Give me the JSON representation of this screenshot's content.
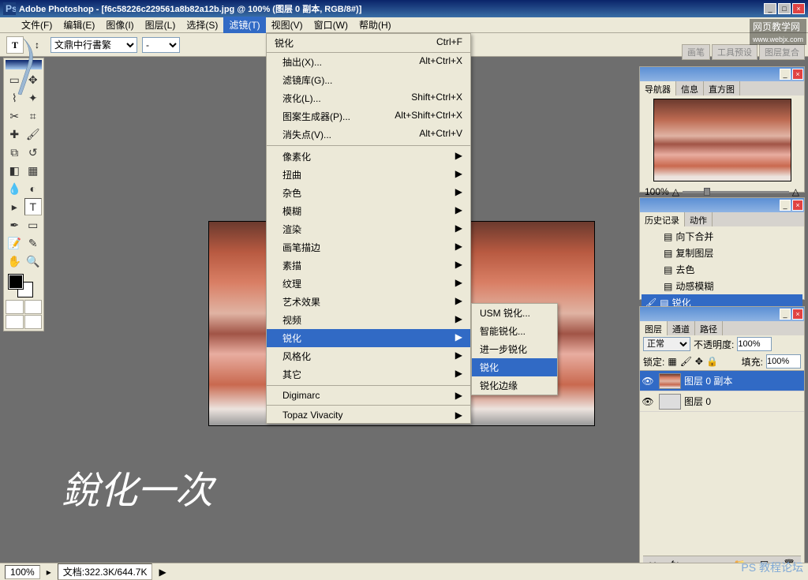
{
  "app": {
    "title": "Adobe Photoshop - [f6c58226c229561a8b82a12b.jpg @ 100% (图层 0 副本, RGB/8#)]"
  },
  "watermark_top": "网页教学网",
  "watermark_url": "www.webjx.com",
  "watermark_bot": "PS 教程论坛",
  "menubar": {
    "file": "文件(F)",
    "edit": "编辑(E)",
    "image": "图像(I)",
    "layer": "图层(L)",
    "select": "选择(S)",
    "filter": "滤镜(T)",
    "view": "视图(V)",
    "window": "窗口(W)",
    "help": "帮助(H)"
  },
  "options": {
    "tool_glyph": "T",
    "font_family": "文鼎中行書繁",
    "font_style": "-",
    "tabwell": {
      "brushes": "画笔",
      "tool_presets": "工具预设",
      "layer_comps": "图层复合"
    }
  },
  "filter_menu": {
    "last": "锐化",
    "last_shortcut": "Ctrl+F",
    "extract": "抽出(X)...",
    "extract_sc": "Alt+Ctrl+X",
    "gallery": "滤镜库(G)...",
    "liquify": "液化(L)...",
    "liquify_sc": "Shift+Ctrl+X",
    "pattern": "图案生成器(P)...",
    "pattern_sc": "Alt+Shift+Ctrl+X",
    "vanish": "消失点(V)...",
    "vanish_sc": "Alt+Ctrl+V",
    "pixelate": "像素化",
    "distort": "扭曲",
    "noise": "杂色",
    "blur": "模糊",
    "render": "渲染",
    "brush_strokes": "画笔描边",
    "sketch": "素描",
    "texture": "纹理",
    "artistic": "艺术效果",
    "video": "视频",
    "sharpen": "锐化",
    "stylize": "风格化",
    "other": "其它",
    "digimarc": "Digimarc",
    "topaz": "Topaz Vivacity"
  },
  "sharpen_submenu": {
    "usm": "USM 锐化...",
    "smart": "智能锐化...",
    "more": "进一步锐化",
    "sharpen": "锐化",
    "edges": "锐化边缘"
  },
  "navigator": {
    "tab_nav": "导航器",
    "tab_info": "信息",
    "tab_histogram": "直方图",
    "zoom": "100%"
  },
  "history": {
    "tab_history": "历史记录",
    "tab_actions": "动作",
    "items": {
      "merge_down": "向下合并",
      "copy_layer": "复制图层",
      "desat": "去色",
      "motion_blur": "动感模糊",
      "sharpen": "锐化"
    }
  },
  "layers": {
    "tab_layers": "图层",
    "tab_channels": "通道",
    "tab_paths": "路径",
    "blend_mode": "正常",
    "opacity_label": "不透明度:",
    "opacity_val": "100%",
    "lock_label": "锁定:",
    "fill_label": "填充:",
    "fill_val": "100%",
    "layer_copy": "图层 0 副本",
    "layer_0": "图层 0"
  },
  "status": {
    "zoom": "100%",
    "doc": "文档:322.3K/644.7K"
  },
  "calligraphy": "銳化一次"
}
